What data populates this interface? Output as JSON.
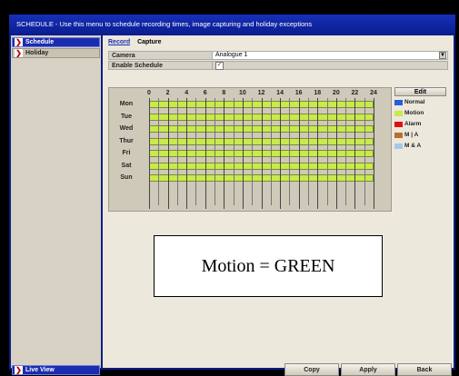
{
  "window": {
    "title": "SCHEDULE - Use this menu to schedule recording times, image capturing and holiday exceptions"
  },
  "sidebar": {
    "items": [
      {
        "label": "Schedule",
        "active": true
      },
      {
        "label": "Holiday",
        "active": false
      }
    ],
    "live_view_label": "Live View"
  },
  "tabs": [
    {
      "label": "Record",
      "active": true
    },
    {
      "label": "Capture",
      "active": false
    }
  ],
  "camera": {
    "label": "Camera",
    "value": "Analogue 1"
  },
  "enable_schedule": {
    "label": "Enable Schedule",
    "checked": true,
    "check_glyph": "✓"
  },
  "schedule": {
    "hours": [
      "0",
      "2",
      "4",
      "6",
      "8",
      "10",
      "12",
      "14",
      "16",
      "18",
      "20",
      "22",
      "24"
    ],
    "days": [
      "Mon",
      "Tue",
      "Wed",
      "Thur",
      "Fri",
      "Sat",
      "Sun"
    ],
    "fill_color": "#c8ea4a"
  },
  "edit_label": "Edit",
  "legend": [
    {
      "label": "Normal",
      "color": "#2a5cd8"
    },
    {
      "label": "Motion",
      "color": "#c8ea4a"
    },
    {
      "label": "Alarm",
      "color": "#e01010"
    },
    {
      "label": "M | A",
      "color": "#b8702a"
    },
    {
      "label": "M & A",
      "color": "#a8c8e8"
    }
  ],
  "annotation": "Motion = GREEN",
  "buttons": {
    "copy": "Copy",
    "apply": "Apply",
    "back": "Back"
  }
}
